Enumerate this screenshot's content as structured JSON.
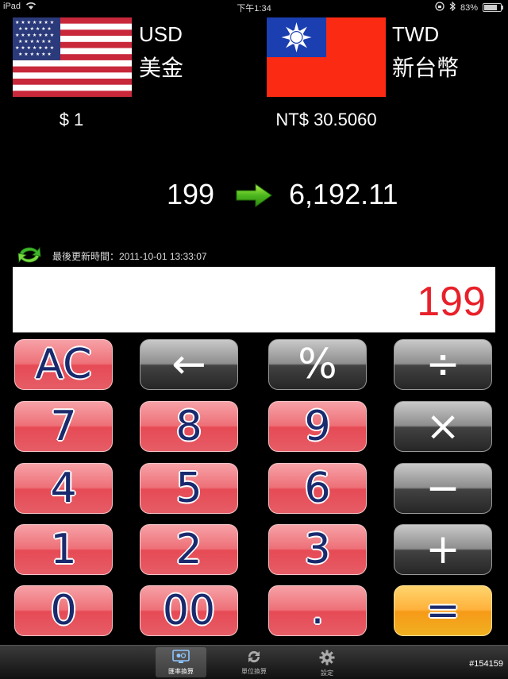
{
  "status": {
    "device": "iPad",
    "time": "下午1:34",
    "battery": "83%"
  },
  "from": {
    "code": "USD",
    "name": "美金",
    "rate": "$ 1"
  },
  "to": {
    "code": "TWD",
    "name": "新台幣",
    "rate": "NT$ 30.5060"
  },
  "conversion": {
    "input": "199",
    "output": "6,192.11"
  },
  "updated": {
    "label": "最後更新時間：2011-10-01 13:33:07"
  },
  "display": {
    "value": "199"
  },
  "keys": {
    "ac": "AC",
    "back": "←",
    "percent": "%",
    "divide": "÷",
    "k7": "7",
    "k8": "8",
    "k9": "9",
    "multiply": "×",
    "k4": "4",
    "k5": "5",
    "k6": "6",
    "minus": "−",
    "k1": "1",
    "k2": "2",
    "k3": "3",
    "plus": "+",
    "k0": "0",
    "k00": "00",
    "dot": ".",
    "equals": "="
  },
  "tabs": [
    {
      "label": "匯率換算",
      "icon": "exchange-icon"
    },
    {
      "label": "單位換算",
      "icon": "refresh-icon"
    },
    {
      "label": "設定",
      "icon": "gear-icon"
    }
  ],
  "watermark": "#154159",
  "colors": {
    "display_text": "#e8202a",
    "key_red": "#e65d66",
    "key_grey": "#424242",
    "key_orange": "#f69a18"
  }
}
